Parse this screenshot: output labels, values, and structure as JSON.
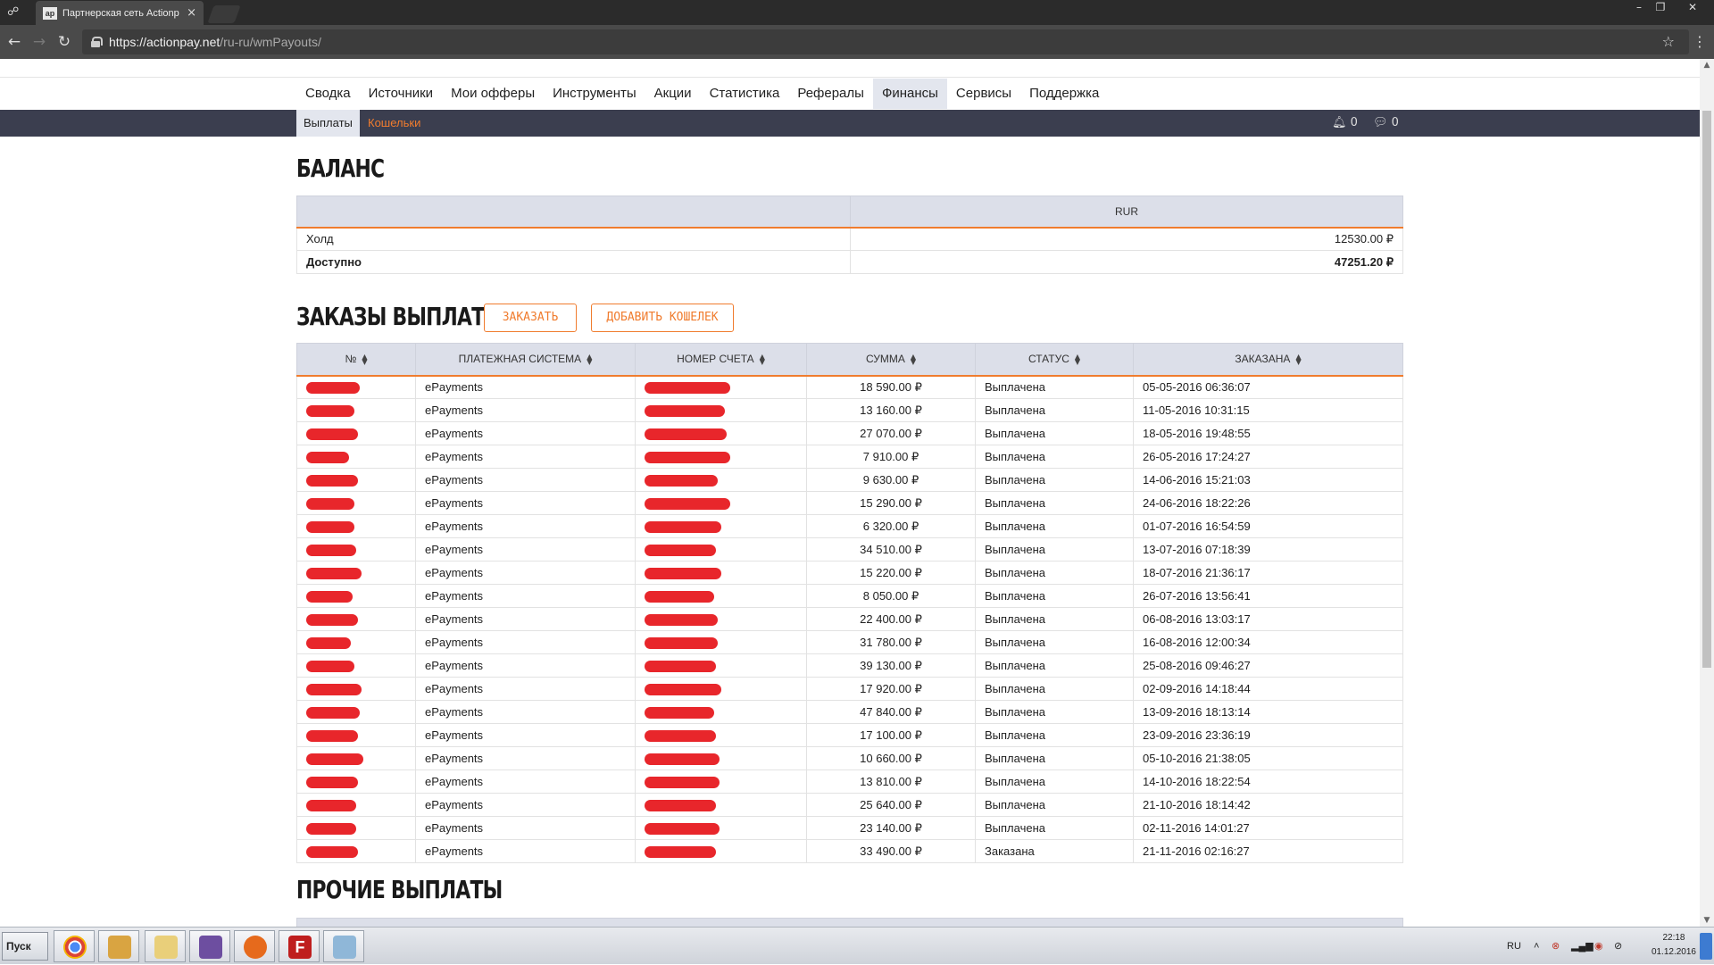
{
  "browser": {
    "tab_title": "Партнерская сеть Actionp",
    "favicon_text": "ap",
    "url_host": "https://actionpay.net",
    "url_path": "/ru-ru/wmPayouts/"
  },
  "main_nav": {
    "items": [
      "Сводка",
      "Источники",
      "Мои офферы",
      "Инструменты",
      "Акции",
      "Статистика",
      "Рефералы",
      "Финансы",
      "Сервисы",
      "Поддержка"
    ],
    "active": "Финансы"
  },
  "sub_nav": {
    "payouts": "Выплаты",
    "wallets": "Кошельки",
    "notifications_count": "0",
    "messages_count": "0"
  },
  "balance": {
    "title": "БАЛАНС",
    "currency": "RUR",
    "rows": [
      {
        "label": "Холд",
        "value": "12530.00 ₽"
      },
      {
        "label": "Доступно",
        "value": "47251.20 ₽"
      }
    ]
  },
  "orders": {
    "title": "ЗАКАЗЫ ВЫПЛАТ",
    "order_button": "ЗАКАЗАТЬ",
    "add_wallet_button": "ДОБАВИТЬ КОШЕЛЕК",
    "columns": [
      "№",
      "Платежная система",
      "Номер счета",
      "Сумма",
      "Статус",
      "Заказана"
    ],
    "rows": [
      {
        "system": "ePayments",
        "sum": "18 590.00 ₽",
        "status": "Выплачена",
        "date": "05-05-2016 06:36:07"
      },
      {
        "system": "ePayments",
        "sum": "13 160.00 ₽",
        "status": "Выплачена",
        "date": "11-05-2016 10:31:15"
      },
      {
        "system": "ePayments",
        "sum": "27 070.00 ₽",
        "status": "Выплачена",
        "date": "18-05-2016 19:48:55"
      },
      {
        "system": "ePayments",
        "sum": "7 910.00 ₽",
        "status": "Выплачена",
        "date": "26-05-2016 17:24:27"
      },
      {
        "system": "ePayments",
        "sum": "9 630.00 ₽",
        "status": "Выплачена",
        "date": "14-06-2016 15:21:03"
      },
      {
        "system": "ePayments",
        "sum": "15 290.00 ₽",
        "status": "Выплачена",
        "date": "24-06-2016 18:22:26"
      },
      {
        "system": "ePayments",
        "sum": "6 320.00 ₽",
        "status": "Выплачена",
        "date": "01-07-2016 16:54:59"
      },
      {
        "system": "ePayments",
        "sum": "34 510.00 ₽",
        "status": "Выплачена",
        "date": "13-07-2016 07:18:39"
      },
      {
        "system": "ePayments",
        "sum": "15 220.00 ₽",
        "status": "Выплачена",
        "date": "18-07-2016 21:36:17"
      },
      {
        "system": "ePayments",
        "sum": "8 050.00 ₽",
        "status": "Выплачена",
        "date": "26-07-2016 13:56:41"
      },
      {
        "system": "ePayments",
        "sum": "22 400.00 ₽",
        "status": "Выплачена",
        "date": "06-08-2016 13:03:17"
      },
      {
        "system": "ePayments",
        "sum": "31 780.00 ₽",
        "status": "Выплачена",
        "date": "16-08-2016 12:00:34"
      },
      {
        "system": "ePayments",
        "sum": "39 130.00 ₽",
        "status": "Выплачена",
        "date": "25-08-2016 09:46:27"
      },
      {
        "system": "ePayments",
        "sum": "17 920.00 ₽",
        "status": "Выплачена",
        "date": "02-09-2016 14:18:44"
      },
      {
        "system": "ePayments",
        "sum": "47 840.00 ₽",
        "status": "Выплачена",
        "date": "13-09-2016 18:13:14"
      },
      {
        "system": "ePayments",
        "sum": "17 100.00 ₽",
        "status": "Выплачена",
        "date": "23-09-2016 23:36:19"
      },
      {
        "system": "ePayments",
        "sum": "10 660.00 ₽",
        "status": "Выплачена",
        "date": "05-10-2016 21:38:05"
      },
      {
        "system": "ePayments",
        "sum": "13 810.00 ₽",
        "status": "Выплачена",
        "date": "14-10-2016 18:22:54"
      },
      {
        "system": "ePayments",
        "sum": "25 640.00 ₽",
        "status": "Выплачена",
        "date": "21-10-2016 18:14:42"
      },
      {
        "system": "ePayments",
        "sum": "23 140.00 ₽",
        "status": "Выплачена",
        "date": "02-11-2016 14:01:27"
      },
      {
        "system": "ePayments",
        "sum": "33 490.00 ₽",
        "status": "Заказана",
        "date": "21-11-2016 02:16:27"
      }
    ]
  },
  "other_payouts": {
    "title": "ПРОЧИЕ ВЫПЛАТЫ"
  },
  "taskbar": {
    "start_label": "Пуск",
    "language": "RU",
    "time": "22:18",
    "date": "01.12.2016"
  },
  "colors": {
    "accent": "#f07c2e",
    "subbar": "#3b3e4f",
    "header_bg": "#dcdfe9",
    "redaction": "#e8262b"
  }
}
